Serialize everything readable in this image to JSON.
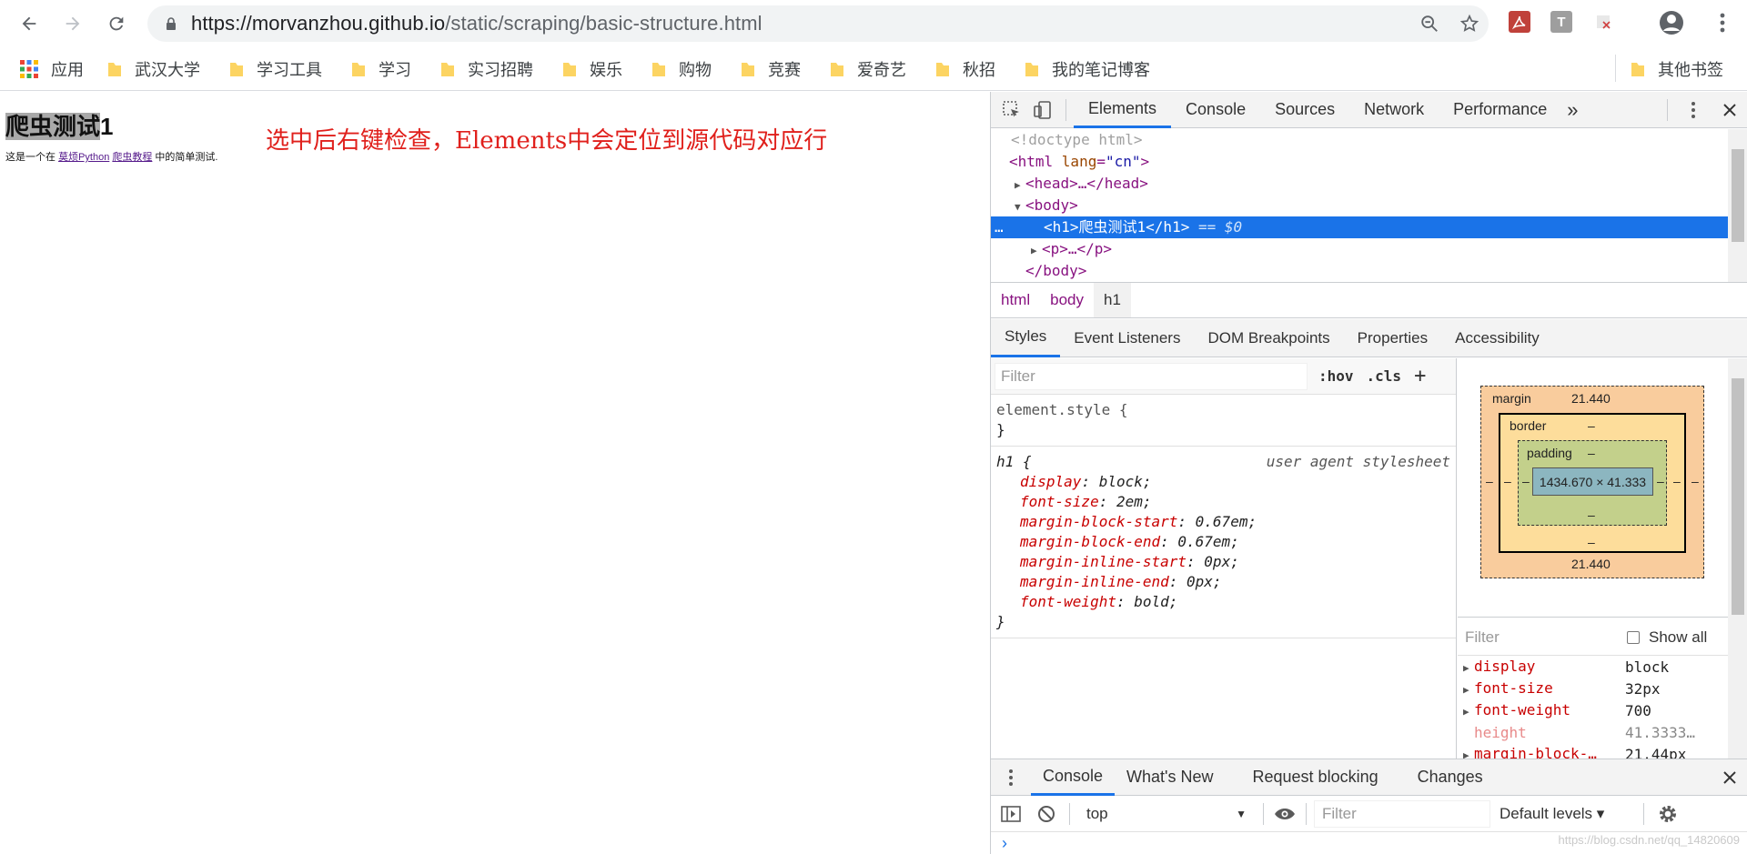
{
  "browser": {
    "url_host": "https://morvanzhou.github.io",
    "url_path": "/static/scraping/basic-structure.html",
    "apps_label": "应用",
    "bookmarks": [
      "武汉大学",
      "学习工具",
      "学习",
      "实习招聘",
      "娱乐",
      "购物",
      "竞赛",
      "爱奇艺",
      "秋招",
      "我的笔记博客"
    ],
    "other_bookmarks": "其他书签",
    "ext_t": "T"
  },
  "page": {
    "h1_highlight": "爬虫测试",
    "h1_rest": "1",
    "para_before": "这是一个在 ",
    "link1": "莫烦Python",
    "link2": "爬虫教程",
    "para_after": " 中的简单测试.",
    "annotation": "选中后右键检查，Elements中会定位到源代码对应行"
  },
  "devtools": {
    "tabs": [
      "Elements",
      "Console",
      "Sources",
      "Network",
      "Performance"
    ],
    "more": "»",
    "dom": {
      "doctype": "<!doctype html>",
      "html_open_tag": "<html ",
      "html_attr": "lang",
      "html_eq": "=",
      "html_val": "\"cn\"",
      "html_close": ">",
      "head": "<head>…</head>",
      "body_open": "<body>",
      "h1_line": "<h1>爬虫测试1</h1>",
      "h1_marker": "== $0",
      "ellipsis": "…",
      "p_line": "<p>…</p>",
      "body_close": "</body>"
    },
    "breadcrumbs": [
      "html",
      "body",
      "h1"
    ],
    "subtabs": [
      "Styles",
      "Event Listeners",
      "DOM Breakpoints",
      "Properties",
      "Accessibility"
    ],
    "styles": {
      "filter_placeholder": "Filter",
      "hov": ":hov",
      "cls": ".cls",
      "plus": "+",
      "element_style_open": "element.style {",
      "close_brace": "}",
      "h1_selector": "h1 {",
      "ua_label": "user agent stylesheet",
      "declarations": [
        {
          "prop": "display",
          "val": "block;"
        },
        {
          "prop": "font-size",
          "val": "2em;"
        },
        {
          "prop": "margin-block-start",
          "val": "0.67em;"
        },
        {
          "prop": "margin-block-end",
          "val": "0.67em;"
        },
        {
          "prop": "margin-inline-start",
          "val": "0px;"
        },
        {
          "prop": "margin-inline-end",
          "val": "0px;"
        },
        {
          "prop": "font-weight",
          "val": "bold;"
        }
      ]
    },
    "box_model": {
      "margin_label": "margin",
      "margin_top": "21.440",
      "margin_bottom": "21.440",
      "border_label": "border",
      "padding_label": "padding",
      "dash": "–",
      "content": "1434.670 × 41.333"
    },
    "computed": {
      "filter_placeholder": "Filter",
      "show_all": "Show all",
      "rows": [
        {
          "name": "display",
          "value": "block"
        },
        {
          "name": "font-size",
          "value": "32px"
        },
        {
          "name": "font-weight",
          "value": "700"
        },
        {
          "name": "height",
          "value": "41.3333…"
        },
        {
          "name": "margin-block-…",
          "value": "21.44px"
        }
      ]
    },
    "drawer": {
      "tabs": [
        "Console",
        "What's New",
        "Request blocking",
        "Changes"
      ],
      "context": "top",
      "filter_placeholder": "Filter",
      "levels": "Default levels ▾",
      "prompt": "›"
    }
  },
  "watermark": "https://blog.csdn.net/qq_14820609",
  "colors": {
    "accent": "#1a73e8",
    "annotation": "#e0201c",
    "tag": "#881280",
    "prop": "#c80000"
  }
}
